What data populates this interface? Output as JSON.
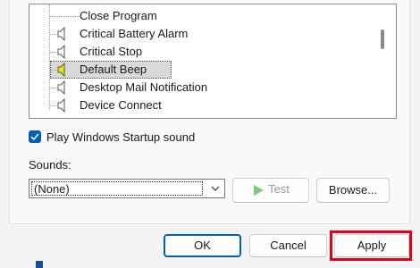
{
  "sound_events": [
    {
      "label": "Close Program",
      "has_icon": false
    },
    {
      "label": "Critical Battery Alarm",
      "has_icon": true
    },
    {
      "label": "Critical Stop",
      "has_icon": true
    },
    {
      "label": "Default Beep",
      "has_icon": true,
      "selected": true
    },
    {
      "label": "Desktop Mail Notification",
      "has_icon": true
    },
    {
      "label": "Device Connect",
      "has_icon": true
    }
  ],
  "startup": {
    "label": "Play Windows Startup sound",
    "checked": true
  },
  "sounds": {
    "label": "Sounds:",
    "value": "(None)"
  },
  "buttons": {
    "test": "Test",
    "browse": "Browse...",
    "ok": "OK",
    "cancel": "Cancel",
    "apply": "Apply"
  },
  "colors": {
    "accent": "#005fb8",
    "highlight": "#e3001b",
    "speaker_selected": "#f2e600"
  },
  "icons": {
    "sound": "speaker-icon",
    "check": "checkmark-icon",
    "play": "play-icon",
    "dropdown": "chevron-down-icon"
  }
}
